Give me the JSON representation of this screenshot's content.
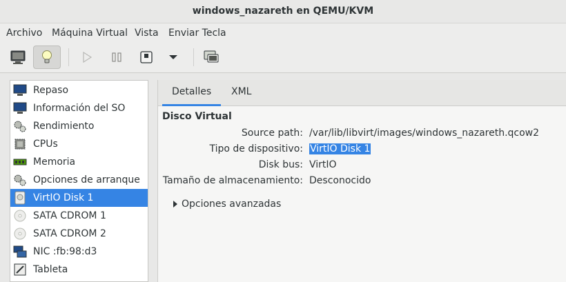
{
  "window": {
    "title": "windows_nazareth en QEMU/KVM"
  },
  "menubar": {
    "items": [
      "Archivo",
      "Máquina Virtual",
      "Vista",
      "Enviar Tecla"
    ]
  },
  "toolbar": {
    "buttons": [
      "monitor-icon",
      "lightbulb-icon",
      "play-icon",
      "pause-icon",
      "power-icon",
      "chevron-down-icon",
      "screenshot-icon"
    ]
  },
  "sidebar": {
    "items": [
      {
        "label": "Repaso",
        "icon": "monitor-icon"
      },
      {
        "label": "Información del SO",
        "icon": "monitor-icon"
      },
      {
        "label": "Rendimiento",
        "icon": "gears-icon"
      },
      {
        "label": "CPUs",
        "icon": "cpu-icon"
      },
      {
        "label": "Memoria",
        "icon": "memory-icon"
      },
      {
        "label": "Opciones de arranque",
        "icon": "gears-icon"
      },
      {
        "label": "VirtIO Disk 1",
        "icon": "disk-icon",
        "selected": true
      },
      {
        "label": "SATA CDROM 1",
        "icon": "cdrom-icon"
      },
      {
        "label": "SATA CDROM 2",
        "icon": "cdrom-icon"
      },
      {
        "label": "NIC :fb:98:d3",
        "icon": "network-icon"
      },
      {
        "label": "Tableta",
        "icon": "tablet-icon"
      }
    ]
  },
  "main": {
    "tabs": [
      {
        "label": "Detalles",
        "active": true
      },
      {
        "label": "XML",
        "active": false
      }
    ],
    "section_title": "Disco Virtual",
    "fields": [
      {
        "label": "Source path:",
        "value": "/var/lib/libvirt/images/windows_nazareth.qcow2"
      },
      {
        "label": "Tipo de dispositivo:",
        "value": "VirtIO Disk 1"
      },
      {
        "label": "Disk bus:",
        "value": "VirtIO"
      },
      {
        "label": "Tamaño de almacenamiento:",
        "value": "Desconocido"
      }
    ],
    "advanced_label": "Opciones avanzadas"
  },
  "colors": {
    "accent": "#3584e4",
    "sidebar_bg": "#ffffff",
    "window_bg": "#e8e8e7"
  }
}
